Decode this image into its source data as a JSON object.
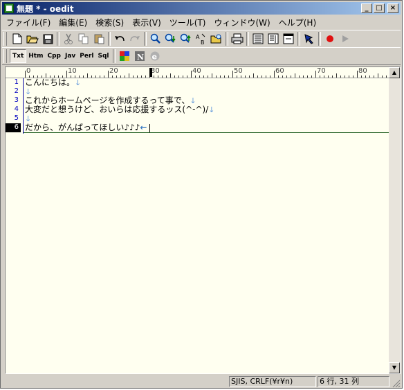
{
  "window": {
    "title": "無題 * - oedit"
  },
  "title_buttons": {
    "minimize": "_",
    "maximize": "□",
    "close": "×"
  },
  "menu": [
    "ファイル(F)",
    "編集(E)",
    "検索(S)",
    "表示(V)",
    "ツール(T)",
    "ウィンドウ(W)",
    "ヘルプ(H)"
  ],
  "toolbar": {
    "buttons": [
      "new-file-icon",
      "open-folder-icon",
      "save-icon",
      "cut-icon",
      "copy-icon",
      "paste-icon",
      "undo-icon",
      "redo-icon",
      "find-icon",
      "find-next-icon",
      "find-prev-icon",
      "replace-icon",
      "find-folder-icon",
      "print-icon",
      "view-text-icon",
      "view-split-icon",
      "view-window-icon",
      "bookmark-icon",
      "record-icon",
      "play-icon"
    ]
  },
  "modes": [
    "Txt",
    "Htm",
    "Cpp",
    "Jav",
    "Perl",
    "Sql"
  ],
  "active_mode": "Txt",
  "ruler": {
    "labels": [
      "0",
      "10",
      "20",
      "30",
      "40",
      "50",
      "60",
      "70",
      "80"
    ]
  },
  "editor": {
    "lines": [
      {
        "no": "1",
        "text": "こんにちは。",
        "end": "↓"
      },
      {
        "no": "2",
        "text": "",
        "end": "↓"
      },
      {
        "no": "3",
        "text": "これからホームページを作成するって事で、",
        "end": "↓"
      },
      {
        "no": "4",
        "text": "大変だと想うけど、おいらは応援するッス(^-^)/",
        "end": "↓"
      },
      {
        "no": "5",
        "text": "",
        "end": "↓"
      },
      {
        "no": "6",
        "text": "だから、がんばってほしい♪♪♪",
        "end": "←"
      }
    ],
    "current_line": 6
  },
  "status": {
    "encoding": "SJIS, CRLF(¥r¥n)",
    "position": "6 行, 31 列"
  },
  "colors": {
    "title_start": "#0a246a",
    "title_end": "#a6caf0",
    "editor_bg": "#fffff0",
    "line_number": "#0000c0"
  }
}
